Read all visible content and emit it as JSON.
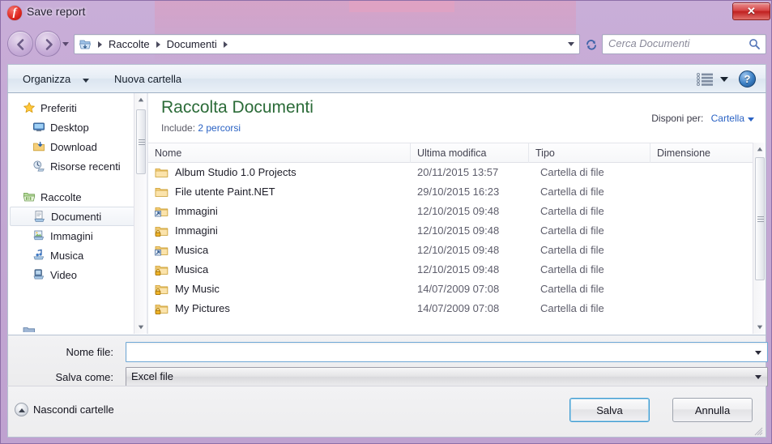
{
  "window": {
    "title": "Save report",
    "app_icon": "flash-player-icon",
    "close_label": "✕"
  },
  "nav": {
    "back_icon": "arrow-left-icon",
    "forward_icon": "arrow-right-icon",
    "history_icon": "chevron-down-icon",
    "breadcrumb_icon": "libraries-icon",
    "breadcrumb": [
      "Raccolte",
      "Documenti"
    ],
    "refresh_icon": "refresh-icon",
    "search_placeholder": "Cerca Documenti",
    "search_value": "",
    "search_icon": "search-icon"
  },
  "toolbar": {
    "organizza_label": "Organizza",
    "nuova_cartella_label": "Nuova cartella",
    "view_icon": "list-view-icon",
    "view_caret_icon": "chevron-down-icon",
    "help_label": "?",
    "help_icon": "help-icon"
  },
  "sidebar": {
    "groups": [
      {
        "header": {
          "label": "Preferiti",
          "icon": "star-icon"
        },
        "items": [
          {
            "label": "Desktop",
            "icon": "desktop-icon",
            "selected": false
          },
          {
            "label": "Download",
            "icon": "download-icon",
            "selected": false
          },
          {
            "label": "Risorse recenti",
            "icon": "recent-places-icon",
            "selected": false
          }
        ]
      },
      {
        "header": {
          "label": "Raccolte",
          "icon": "libraries-icon"
        },
        "items": [
          {
            "label": "Documenti",
            "icon": "documents-library-icon",
            "selected": true
          },
          {
            "label": "Immagini",
            "icon": "pictures-library-icon",
            "selected": false
          },
          {
            "label": "Musica",
            "icon": "music-library-icon",
            "selected": false
          },
          {
            "label": "Video",
            "icon": "video-library-icon",
            "selected": false
          }
        ]
      }
    ],
    "scroll_up_icon": "scroll-up-arrow-icon",
    "scroll_down_icon": "scroll-down-arrow-icon"
  },
  "main": {
    "library_title": "Raccolta Documenti",
    "includes_label": "Include:",
    "includes_link": "2 percorsi",
    "arrange_label": "Disponi per:",
    "arrange_value": "Cartella",
    "columns": [
      "Nome",
      "Ultima modifica",
      "Tipo",
      "Dimensione"
    ],
    "sort_column": "Nome",
    "sort_direction": "ascending",
    "rows": [
      {
        "name": "Album Studio 1.0 Projects",
        "modified": "20/11/2015 13:57",
        "type": "Cartella di file",
        "size": "",
        "icon": "folder-icon"
      },
      {
        "name": "File utente Paint.NET",
        "modified": "29/10/2015 16:23",
        "type": "Cartella di file",
        "size": "",
        "icon": "folder-icon"
      },
      {
        "name": "Immagini",
        "modified": "12/10/2015 09:48",
        "type": "Cartella di file",
        "size": "",
        "icon": "folder-shortcut-icon"
      },
      {
        "name": "Immagini",
        "modified": "12/10/2015 09:48",
        "type": "Cartella di file",
        "size": "",
        "icon": "folder-locked-icon"
      },
      {
        "name": "Musica",
        "modified": "12/10/2015 09:48",
        "type": "Cartella di file",
        "size": "",
        "icon": "folder-shortcut-icon"
      },
      {
        "name": "Musica",
        "modified": "12/10/2015 09:48",
        "type": "Cartella di file",
        "size": "",
        "icon": "folder-locked-icon"
      },
      {
        "name": "My Music",
        "modified": "14/07/2009 07:08",
        "type": "Cartella di file",
        "size": "",
        "icon": "folder-locked-icon"
      },
      {
        "name": "My Pictures",
        "modified": "14/07/2009 07:08",
        "type": "Cartella di file",
        "size": "",
        "icon": "folder-locked-icon"
      }
    ]
  },
  "form": {
    "filename_label": "Nome file:",
    "filename_value": "",
    "filename_placeholder": "",
    "savetype_label": "Salva come:",
    "savetype_value": "Excel file"
  },
  "footer": {
    "hide_folders_label": "Nascondi cartelle",
    "hide_folders_icon": "chevron-up-circle-icon",
    "save_label": "Salva",
    "cancel_label": "Annulla"
  },
  "colors": {
    "window_chrome": "#c2a6d2",
    "library_title": "#2b6b38",
    "link": "#2a62c4",
    "close_button": "#c02020",
    "focus_border": "#3f9bd1"
  }
}
